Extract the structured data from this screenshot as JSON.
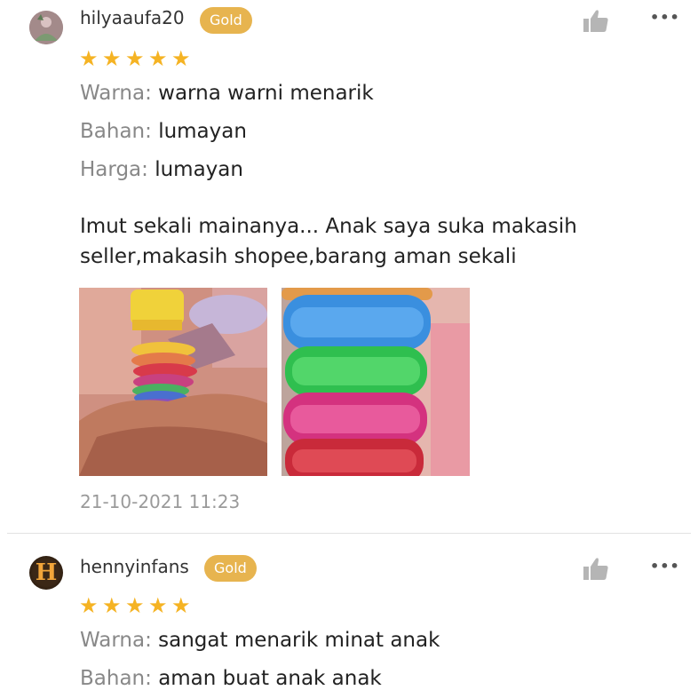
{
  "reviews": [
    {
      "username": "hilyaaufa20",
      "badge": "Gold",
      "rating": 5,
      "attributes": [
        {
          "label": "Warna:",
          "value": "warna warni menarik"
        },
        {
          "label": "Bahan:",
          "value": "lumayan"
        },
        {
          "label": "Harga:",
          "value": "lumayan"
        }
      ],
      "comment_line1": "Imut sekali mainanya... Anak saya suka makasih",
      "comment_line2": "seller,makasih shopee,barang aman sekali",
      "timestamp": "21-10-2021 11:23"
    },
    {
      "username": "hennyinfans",
      "badge": "Gold",
      "avatar_letter": "H",
      "rating": 5,
      "attributes": [
        {
          "label": "Warna:",
          "value": "sangat menarik minat anak"
        },
        {
          "label": "Bahan:",
          "value": "aman buat anak anak"
        }
      ]
    }
  ],
  "icons": {
    "like": "thumbs-up-icon",
    "more": "more-options-icon",
    "star": "star-icon"
  },
  "colors": {
    "badge_gold": "#e7b44f",
    "star": "#f5b323",
    "label_gray": "#888888"
  }
}
